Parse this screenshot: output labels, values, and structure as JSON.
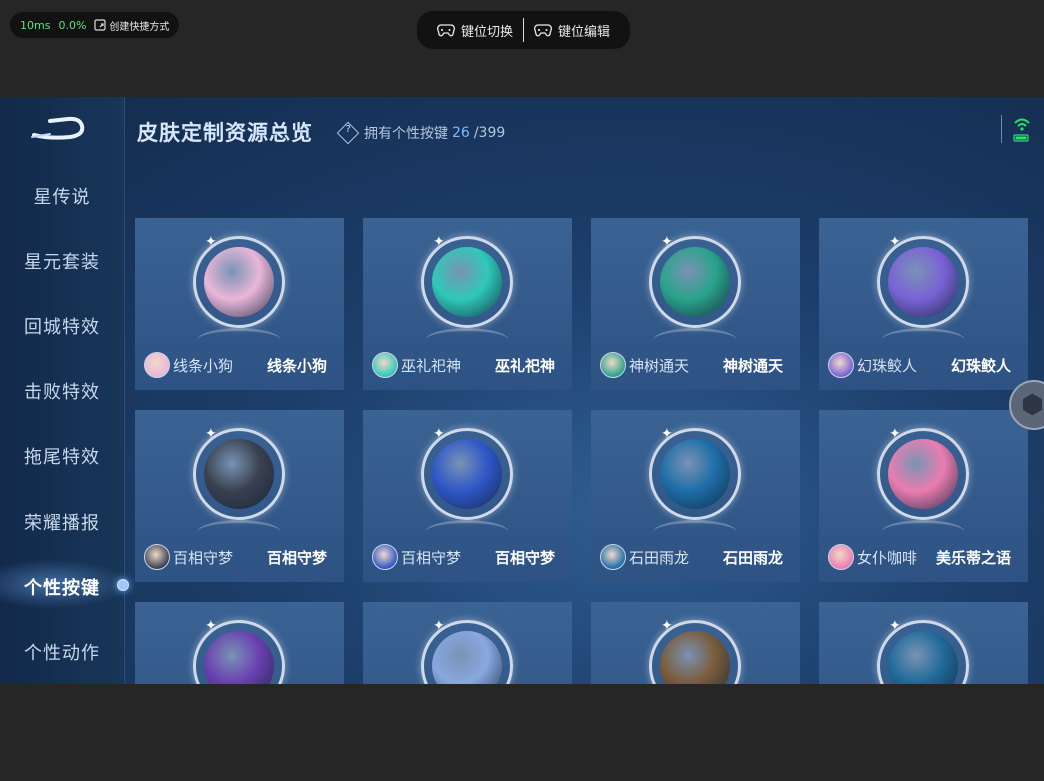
{
  "status": {
    "ping": "10ms",
    "loss": "0.0%",
    "shortcut_label": "创建快捷方式"
  },
  "keybar": {
    "switch_label": "键位切换",
    "edit_label": "键位编辑"
  },
  "header": {
    "title": "皮肤定制资源总览",
    "owned_prefix": "拥有个性按键",
    "owned_count": "26",
    "owned_total": "/399"
  },
  "sidebar": {
    "items": [
      {
        "label": "星传说"
      },
      {
        "label": "星元套装"
      },
      {
        "label": "回城特效"
      },
      {
        "label": "击败特效"
      },
      {
        "label": "拖尾特效"
      },
      {
        "label": "荣耀播报"
      },
      {
        "label": "个性按键",
        "active": true
      },
      {
        "label": "个性动作"
      }
    ]
  },
  "cards": [
    {
      "hero": "线条小狗",
      "skin": "线条小狗",
      "color": "#e9b6d9"
    },
    {
      "hero": "巫礼祀神",
      "skin": "巫礼祀神",
      "color": "#2fc9b8"
    },
    {
      "hero": "神树通天",
      "skin": "神树通天",
      "color": "#2aa38a"
    },
    {
      "hero": "幻珠鲛人",
      "skin": "幻珠鲛人",
      "color": "#7a62d6"
    },
    {
      "hero": "百相守梦",
      "skin": "百相守梦",
      "color": "#3a4150"
    },
    {
      "hero": "百相守梦",
      "skin": "百相守梦",
      "color": "#2f57c8"
    },
    {
      "hero": "石田雨龙",
      "skin": "石田雨龙",
      "color": "#1d6ea8"
    },
    {
      "hero": "女仆咖啡",
      "skin": "美乐蒂之语",
      "color": "#ea7db0"
    },
    {
      "hero": "",
      "skin": "",
      "color": "#6a3fb0"
    },
    {
      "hero": "",
      "skin": "",
      "color": "#8aa7e0"
    },
    {
      "hero": "",
      "skin": "",
      "color": "#7a5b3a"
    },
    {
      "hero": "",
      "skin": "",
      "color": "#1f6a9a"
    }
  ]
}
